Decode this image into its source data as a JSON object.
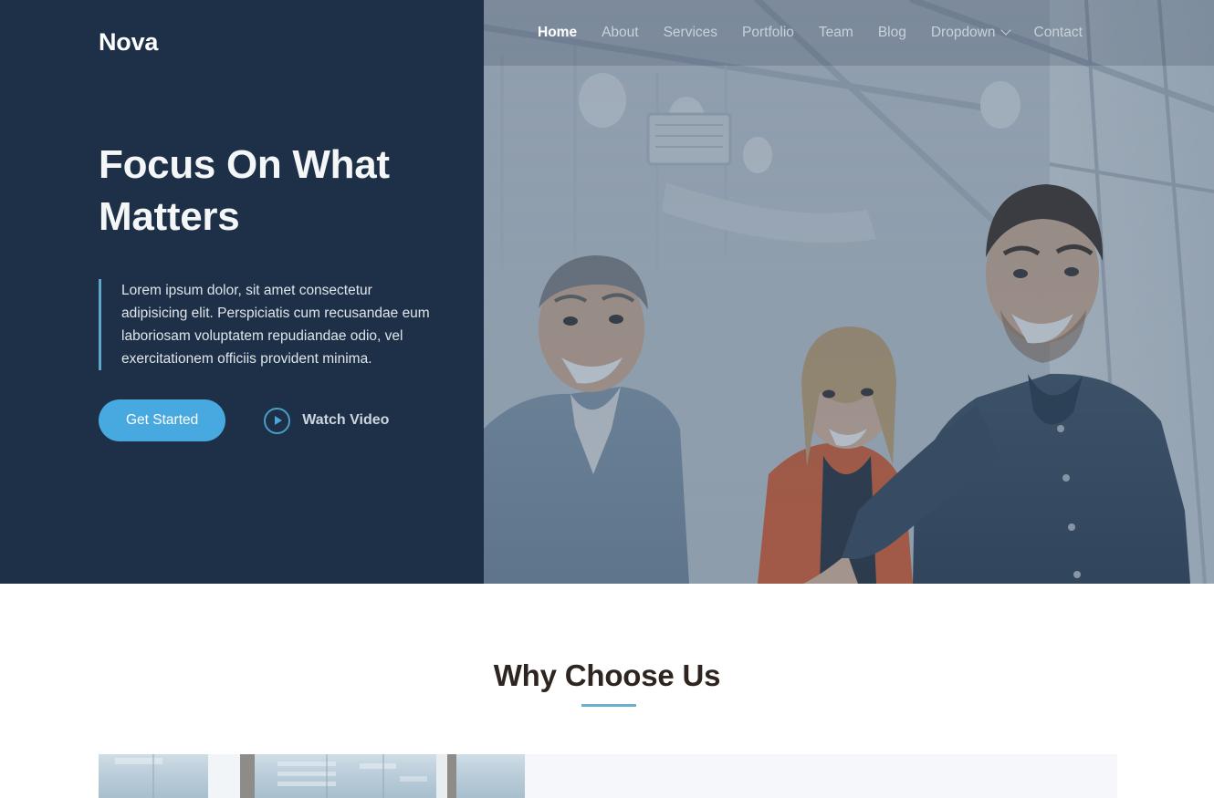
{
  "brand": {
    "name": "Nova"
  },
  "nav": {
    "items": [
      {
        "label": "Home",
        "active": true,
        "icon": null
      },
      {
        "label": "About",
        "active": false,
        "icon": null
      },
      {
        "label": "Services",
        "active": false,
        "icon": null
      },
      {
        "label": "Portfolio",
        "active": false,
        "icon": null
      },
      {
        "label": "Team",
        "active": false,
        "icon": null
      },
      {
        "label": "Blog",
        "active": false,
        "icon": null
      },
      {
        "label": "Dropdown",
        "active": false,
        "icon": "chevron-down-icon"
      },
      {
        "label": "Contact",
        "active": false,
        "icon": null
      }
    ]
  },
  "hero": {
    "title": "Focus On What Matters",
    "description": "Lorem ipsum dolor, sit amet consectetur adipisicing elit. Perspiciatis cum recusandae eum laboriosam voluptatem repudiandae odio, vel exercitationem officiis provident minima.",
    "primary_cta": "Get Started",
    "video_cta": "Watch Video",
    "video_icon": "play-circle-icon",
    "image_alt": "three-colleagues-smiling-in-modern-office"
  },
  "why_choose_us": {
    "title": "Why Choose Us",
    "divider": "section-divider"
  },
  "feature_card": {
    "image_alt": "glass-office-building-facade"
  },
  "colors": {
    "navy": "#1d3047",
    "accent_blue": "#47a9e0",
    "divider_blue": "#6bb0cc",
    "panel_gray": "#f5f7fa",
    "heading_dark": "#2e2520"
  }
}
